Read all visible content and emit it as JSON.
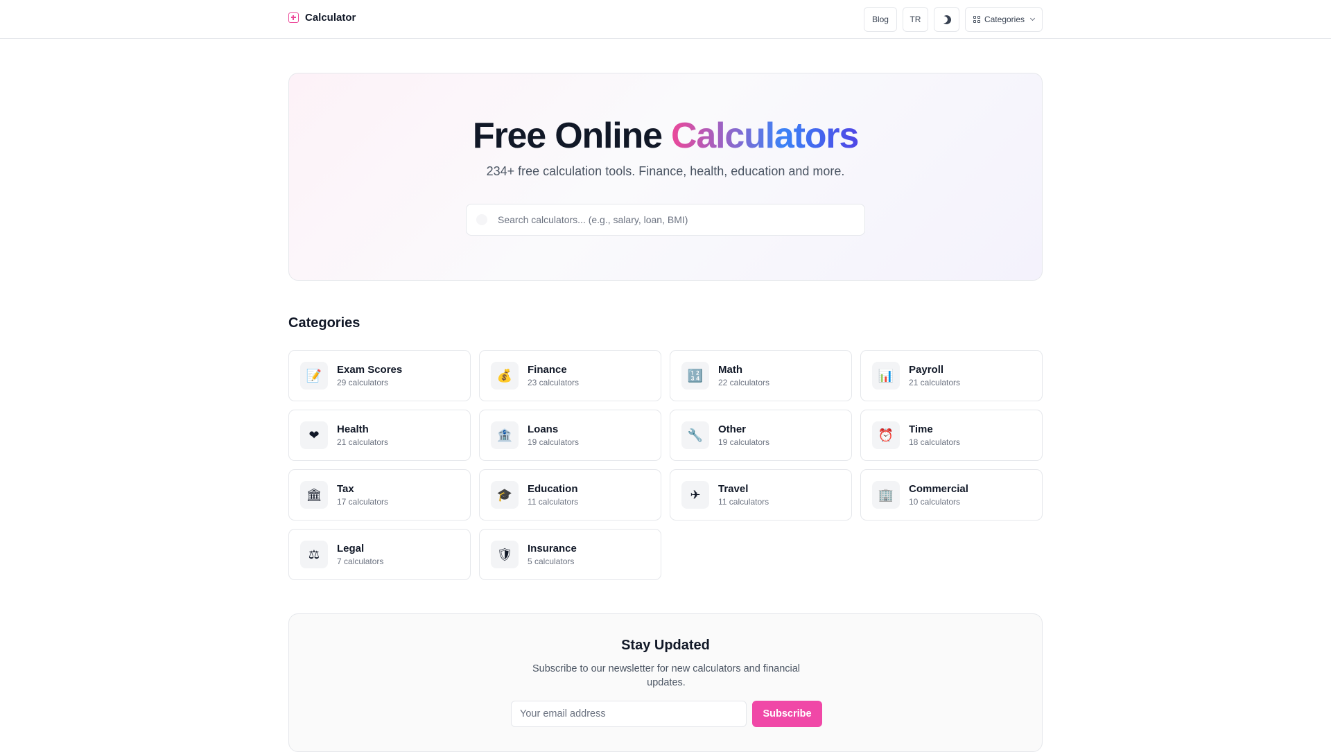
{
  "nav": {
    "brand": "Calculator",
    "blog": "Blog",
    "lang": "TR",
    "categories": "Categories"
  },
  "hero": {
    "title_plain": "Free Online ",
    "title_accent": "Calculators",
    "subtitle": "234+ free calculation tools. Finance, health, education and more.",
    "search_placeholder": "Search calculators... (e.g., salary, loan, BMI)"
  },
  "categories": {
    "heading": "Categories",
    "items": [
      {
        "name": "Exam Scores",
        "count": "29 calculators",
        "icon": "📝"
      },
      {
        "name": "Finance",
        "count": "23 calculators",
        "icon": "💰"
      },
      {
        "name": "Math",
        "count": "22 calculators",
        "icon": "🔢"
      },
      {
        "name": "Payroll",
        "count": "21 calculators",
        "icon": "📊"
      },
      {
        "name": "Health",
        "count": "21 calculators",
        "icon": "❤"
      },
      {
        "name": "Loans",
        "count": "19 calculators",
        "icon": "🏦"
      },
      {
        "name": "Other",
        "count": "19 calculators",
        "icon": "🔧"
      },
      {
        "name": "Time",
        "count": "18 calculators",
        "icon": "⏰"
      },
      {
        "name": "Tax",
        "count": "17 calculators",
        "icon": "🏛"
      },
      {
        "name": "Education",
        "count": "11 calculators",
        "icon": "🎓"
      },
      {
        "name": "Travel",
        "count": "11 calculators",
        "icon": "✈"
      },
      {
        "name": "Commercial",
        "count": "10 calculators",
        "icon": "🏢"
      },
      {
        "name": "Legal",
        "count": "7 calculators",
        "icon": "⚖"
      },
      {
        "name": "Insurance",
        "count": "5 calculators",
        "icon": "🛡"
      }
    ]
  },
  "newsletter": {
    "title": "Stay Updated",
    "description": "Subscribe to our newsletter for new calculators and financial updates.",
    "email_placeholder": "Your email address",
    "button": "Subscribe"
  },
  "colors": {
    "accent": "#ec4899",
    "button": "#f048a7",
    "gradient_end": "#4f46e5"
  }
}
